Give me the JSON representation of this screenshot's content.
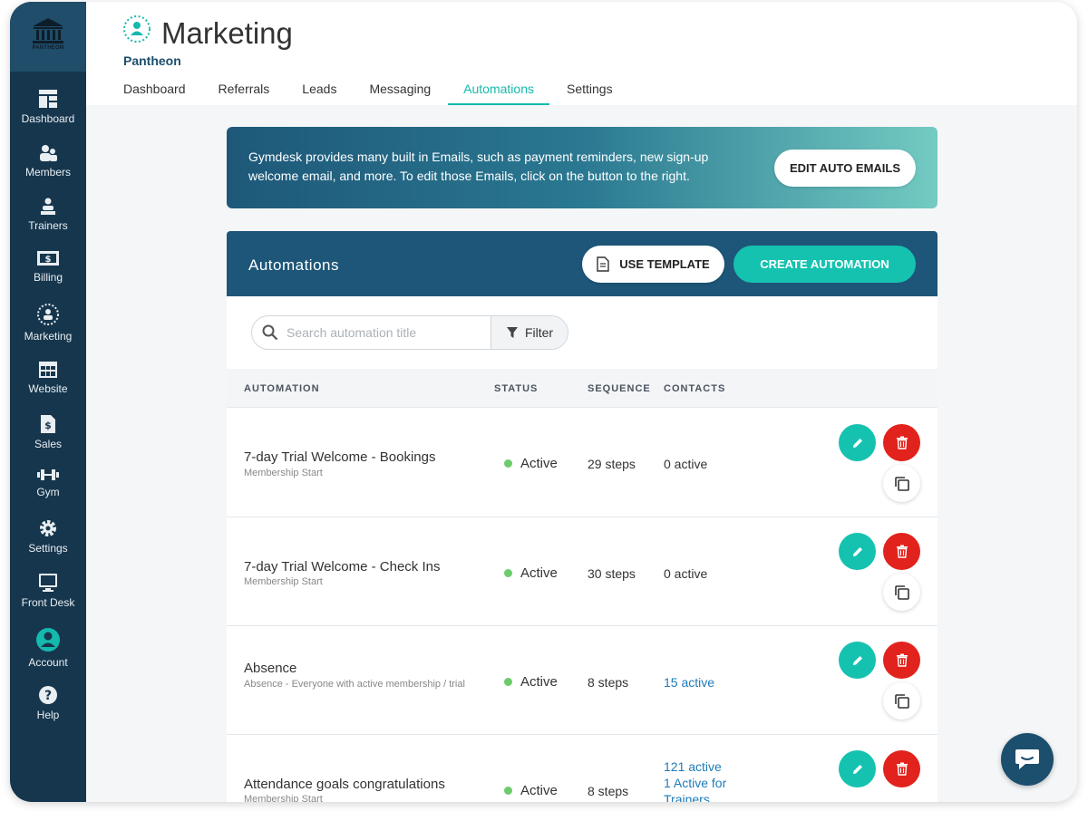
{
  "sidebar": {
    "logo_text": "PANTHEON",
    "items": [
      {
        "label": "Dashboard",
        "icon": "dashboard-icon"
      },
      {
        "label": "Members",
        "icon": "members-icon"
      },
      {
        "label": "Trainers",
        "icon": "trainers-icon"
      },
      {
        "label": "Billing",
        "icon": "billing-icon"
      },
      {
        "label": "Marketing",
        "icon": "marketing-icon"
      },
      {
        "label": "Website",
        "icon": "website-icon"
      },
      {
        "label": "Sales",
        "icon": "sales-icon"
      },
      {
        "label": "Gym",
        "icon": "dumbbell-icon"
      },
      {
        "label": "Settings",
        "icon": "gear-icon"
      },
      {
        "label": "Front Desk",
        "icon": "monitor-icon"
      },
      {
        "label": "Account",
        "icon": "user-avatar-icon"
      },
      {
        "label": "Help",
        "icon": "help-icon"
      }
    ]
  },
  "header": {
    "title": "Marketing",
    "org": "Pantheon",
    "tabs": [
      {
        "label": "Dashboard"
      },
      {
        "label": "Referrals"
      },
      {
        "label": "Leads"
      },
      {
        "label": "Messaging"
      },
      {
        "label": "Automations"
      },
      {
        "label": "Settings"
      }
    ],
    "active_tab": "Automations"
  },
  "banner": {
    "text": "Gymdesk provides many built in Emails, such as payment reminders, new sign-up welcome email, and more. To edit those Emails, click on the button to the right.",
    "button": "EDIT AUTO EMAILS"
  },
  "automations": {
    "title": "Automations",
    "use_template": "USE TEMPLATE",
    "create": "CREATE AUTOMATION",
    "search_placeholder": "Search automation title",
    "filter": "Filter",
    "columns": [
      "AUTOMATION",
      "STATUS",
      "SEQUENCE",
      "CONTACTS"
    ],
    "rows": [
      {
        "name": "7-day Trial Welcome - Bookings",
        "sub": "Membership Start",
        "status": "Active",
        "sequence": "29 steps",
        "contacts": [
          "0 active"
        ]
      },
      {
        "name": "7-day Trial Welcome - Check Ins",
        "sub": "Membership Start",
        "status": "Active",
        "sequence": "30 steps",
        "contacts": [
          "0 active"
        ]
      },
      {
        "name": "Absence",
        "sub": "Absence - Everyone with active membership / trial",
        "status": "Active",
        "sequence": "8 steps",
        "contacts": [
          "15 active"
        ]
      },
      {
        "name": "Attendance goals congratulations",
        "sub": "Membership Start",
        "status": "Active",
        "sequence": "8 steps",
        "contacts": [
          "121 active",
          "1 Active for",
          "Trainers"
        ]
      }
    ]
  },
  "colors": {
    "sidebar": "#16364d",
    "accent_teal": "#15c2b0",
    "header_blue": "#1d5678",
    "delete_red": "#e2221c",
    "status_green": "#6ccc6c",
    "link_blue": "#1f7ab8"
  }
}
